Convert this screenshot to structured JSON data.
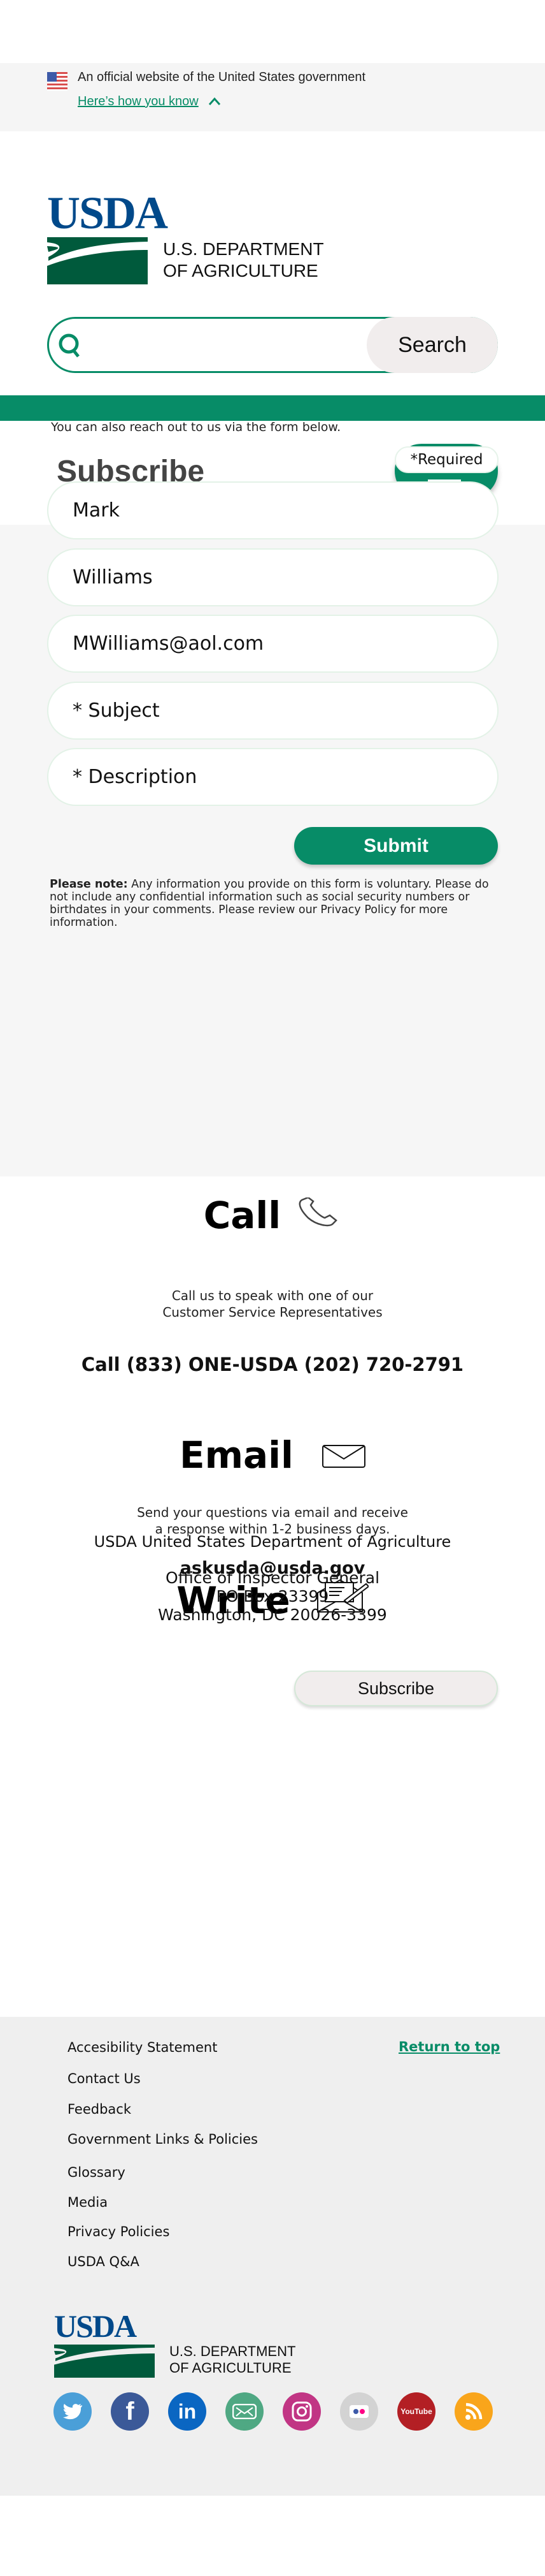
{
  "gov_banner": {
    "text": "An official website of the United States government",
    "link": "Here’s how you know"
  },
  "header": {
    "logo_text": "USDA",
    "dept_line1": "U.S. DEPARTMENT",
    "dept_line2": "OF AGRICULTURE",
    "search_placeholder": "",
    "search_button": "Search"
  },
  "page": {
    "title": "Subscribe"
  },
  "form": {
    "intro": "You can also reach out to us via the form below.",
    "required": "*Required",
    "fields": [
      {
        "value": "Mark"
      },
      {
        "value": "Williams"
      },
      {
        "value": "MWilliams@aol.com"
      },
      {
        "placeholder": "* Subject"
      },
      {
        "placeholder": "* Description"
      }
    ],
    "submit": "Submit",
    "note_bold": "Please note:",
    "note": " Any information you provide on this form is voluntary. Please do not include any confidential information such as social security numbers or birthdates in your comments. Please review our Privacy Policy for more information."
  },
  "contact": {
    "call": {
      "title": "Call",
      "line1": "Call us to speak with one of our",
      "line2": "Customer Service Representatives",
      "number": "Call (833) ONE-USDA (202) 720-2791"
    },
    "email": {
      "title": "Email",
      "line1": "Send your questions via email and receive",
      "line2": "a response within 1-2 business days.",
      "address": "askusda@usda.gov"
    },
    "write": {
      "title": "Write",
      "org": "USDA United States Department of Agriculture",
      "addr1": "Office of Inspector General",
      "addr2": "PO Box 23399",
      "addr3": "Washington, DC 20026-3399"
    },
    "subscribe_button": "Subscribe"
  },
  "footer": {
    "links": [
      "Accesibility Statement",
      "Contact Us",
      "Feedback",
      "Government Links & Policies",
      "Glossary",
      "Media",
      "Privacy Policies",
      "USDA Q&A"
    ],
    "return_to_top": "Return to top",
    "logo_text": "USDA",
    "dept_line1": "U.S. DEPARTMENT",
    "dept_line2": "OF AGRICULTURE",
    "social": [
      {
        "name": "twitter",
        "color": "#4a9fd8"
      },
      {
        "name": "facebook",
        "color": "#3b5998"
      },
      {
        "name": "linkedin",
        "color": "#0a66c2",
        "glyph": "in"
      },
      {
        "name": "email",
        "color": "#4fa883"
      },
      {
        "name": "instagram",
        "color": "#c13584"
      },
      {
        "name": "flickr",
        "color": "#d3d3d3"
      },
      {
        "name": "youtube",
        "color": "#b31f24",
        "glyph": "YouTube"
      },
      {
        "name": "rss",
        "color": "#f9a51b"
      }
    ]
  },
  "colors": {
    "brand_green": "#078c67",
    "usda_blue": "#00498a",
    "logo_green": "#005a3c"
  }
}
